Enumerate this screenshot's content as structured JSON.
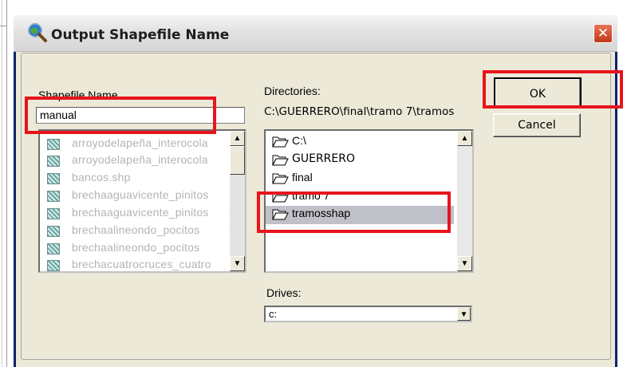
{
  "dialog": {
    "title": "Output Shapefile Name",
    "close_label": "✕"
  },
  "shapefile": {
    "label": "Shapefile Name",
    "value": "manual",
    "files": [
      "arroyodelapeña_interocola",
      "arroyodelapeña_interocola",
      "bancos.shp",
      "brechaaguavicente_pinitos",
      "brechaaguavicente_pinitos",
      "brechaalineondo_pocitos",
      "brechaalineondo_pocitos",
      "brechacuatrocruces_cuatro"
    ]
  },
  "directories": {
    "label": "Directories:",
    "current_path": "C:\\GUERRERO\\final\\tramo 7\\tramos",
    "items": [
      {
        "label": "C:\\",
        "selected": false
      },
      {
        "label": "GUERRERO",
        "selected": false
      },
      {
        "label": "final",
        "selected": false
      },
      {
        "label": "tramo 7",
        "selected": false
      },
      {
        "label": "tramosshap",
        "selected": true
      }
    ]
  },
  "drives": {
    "label": "Drives:",
    "selected": "c:"
  },
  "buttons": {
    "ok": "OK",
    "cancel": "Cancel"
  },
  "colors": {
    "highlight_red": "#e8141c",
    "dialog_face": "#ece9d8"
  }
}
